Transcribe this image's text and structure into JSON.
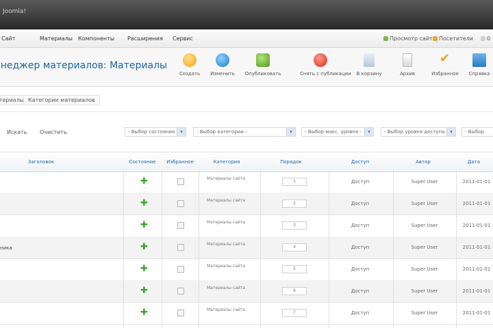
{
  "window": {
    "title": "Joomla!"
  },
  "menu": {
    "items": [
      "Сайт",
      "Материалы",
      "Компоненты",
      "Расширения",
      "Сервис"
    ],
    "right": [
      {
        "label": "Просмотр сайта",
        "color": "#7ab648"
      },
      {
        "label": "Посетители",
        "color": "#e9a53b"
      },
      {
        "label": "0",
        "color": "#d0d0d0"
      }
    ]
  },
  "toolbar": {
    "title": "Менеджер материалов: Материалы",
    "buttons": [
      {
        "label": "Создать",
        "icon": "new-icon"
      },
      {
        "label": "Изменить",
        "icon": "edit-icon"
      },
      {
        "label": "Опубликовать",
        "icon": "publish-icon"
      },
      {
        "label": "Снять с публикации",
        "icon": "unpublish-icon"
      },
      {
        "label": "В корзину",
        "icon": "trash-icon"
      },
      {
        "label": "Архив",
        "icon": "archive-icon"
      },
      {
        "label": "Избранное",
        "icon": "featured-icon"
      },
      {
        "label": "Справка",
        "icon": "help-icon"
      }
    ]
  },
  "subnav": {
    "items": [
      "Материалы",
      "Категории материалов"
    ]
  },
  "filters": {
    "search_btn": "Искать",
    "clear_btn": "Очистить",
    "selects": [
      "- Выбор состояния -",
      "- Выбор категории -",
      "- Выбор макс. уровня -",
      "- Выбор уровня доступа -",
      "- Выбор автора -"
    ],
    "arrow": "▾"
  },
  "table": {
    "headers": [
      "Заголовок",
      "Состояние",
      "Избранное",
      "Категория",
      "Порядок",
      "Доступ",
      "Автор",
      "Дата"
    ],
    "rows": [
      {
        "title": "",
        "category": "Материалы сайта",
        "order": "1",
        "access": "Доступ",
        "author": "Super User",
        "date": "2011-01-01"
      },
      {
        "title": "",
        "category": "Материалы сайта",
        "order": "2",
        "access": "Доступ",
        "author": "Super User",
        "date": "2011-01-01"
      },
      {
        "title": "",
        "category": "Материалы сайта",
        "order": "3",
        "access": "Доступ",
        "author": "Super User",
        "date": "2011-01-01"
      },
      {
        "title": "ника",
        "category": "Материалы сайта",
        "order": "4",
        "access": "Доступ",
        "author": "Super User",
        "date": "2011-01-01"
      },
      {
        "title": "",
        "category": "Материалы сайта",
        "order": "5",
        "access": "Доступ",
        "author": "Super User",
        "date": "2011-01-01"
      },
      {
        "title": "",
        "category": "Материалы сайта",
        "order": "6",
        "access": "Доступ",
        "author": "Super User",
        "date": "2011-01-01"
      },
      {
        "title": "",
        "category": "Материалы сайта",
        "order": "7",
        "access": "Доступ",
        "author": "Super User",
        "date": "2011-01-01"
      }
    ]
  },
  "colors": {
    "accent": "#1a66a8",
    "published": "#3aa82a"
  }
}
